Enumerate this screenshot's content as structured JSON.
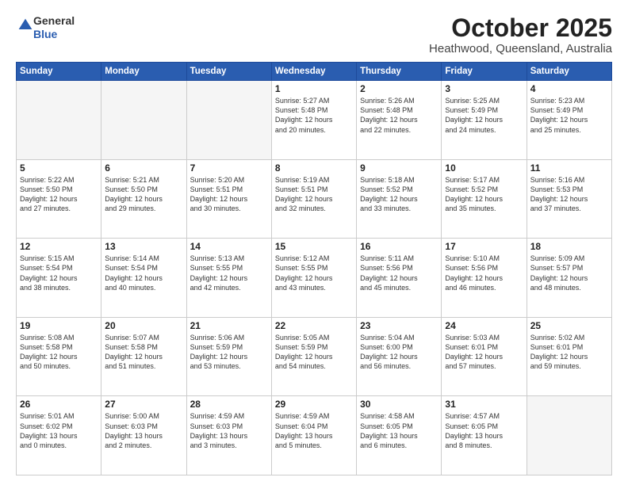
{
  "logo": {
    "general": "General",
    "blue": "Blue"
  },
  "header": {
    "month": "October 2025",
    "location": "Heathwood, Queensland, Australia"
  },
  "weekdays": [
    "Sunday",
    "Monday",
    "Tuesday",
    "Wednesday",
    "Thursday",
    "Friday",
    "Saturday"
  ],
  "weeks": [
    [
      {
        "day": "",
        "info": ""
      },
      {
        "day": "",
        "info": ""
      },
      {
        "day": "",
        "info": ""
      },
      {
        "day": "1",
        "info": "Sunrise: 5:27 AM\nSunset: 5:48 PM\nDaylight: 12 hours\nand 20 minutes."
      },
      {
        "day": "2",
        "info": "Sunrise: 5:26 AM\nSunset: 5:48 PM\nDaylight: 12 hours\nand 22 minutes."
      },
      {
        "day": "3",
        "info": "Sunrise: 5:25 AM\nSunset: 5:49 PM\nDaylight: 12 hours\nand 24 minutes."
      },
      {
        "day": "4",
        "info": "Sunrise: 5:23 AM\nSunset: 5:49 PM\nDaylight: 12 hours\nand 25 minutes."
      }
    ],
    [
      {
        "day": "5",
        "info": "Sunrise: 5:22 AM\nSunset: 5:50 PM\nDaylight: 12 hours\nand 27 minutes."
      },
      {
        "day": "6",
        "info": "Sunrise: 5:21 AM\nSunset: 5:50 PM\nDaylight: 12 hours\nand 29 minutes."
      },
      {
        "day": "7",
        "info": "Sunrise: 5:20 AM\nSunset: 5:51 PM\nDaylight: 12 hours\nand 30 minutes."
      },
      {
        "day": "8",
        "info": "Sunrise: 5:19 AM\nSunset: 5:51 PM\nDaylight: 12 hours\nand 32 minutes."
      },
      {
        "day": "9",
        "info": "Sunrise: 5:18 AM\nSunset: 5:52 PM\nDaylight: 12 hours\nand 33 minutes."
      },
      {
        "day": "10",
        "info": "Sunrise: 5:17 AM\nSunset: 5:52 PM\nDaylight: 12 hours\nand 35 minutes."
      },
      {
        "day": "11",
        "info": "Sunrise: 5:16 AM\nSunset: 5:53 PM\nDaylight: 12 hours\nand 37 minutes."
      }
    ],
    [
      {
        "day": "12",
        "info": "Sunrise: 5:15 AM\nSunset: 5:54 PM\nDaylight: 12 hours\nand 38 minutes."
      },
      {
        "day": "13",
        "info": "Sunrise: 5:14 AM\nSunset: 5:54 PM\nDaylight: 12 hours\nand 40 minutes."
      },
      {
        "day": "14",
        "info": "Sunrise: 5:13 AM\nSunset: 5:55 PM\nDaylight: 12 hours\nand 42 minutes."
      },
      {
        "day": "15",
        "info": "Sunrise: 5:12 AM\nSunset: 5:55 PM\nDaylight: 12 hours\nand 43 minutes."
      },
      {
        "day": "16",
        "info": "Sunrise: 5:11 AM\nSunset: 5:56 PM\nDaylight: 12 hours\nand 45 minutes."
      },
      {
        "day": "17",
        "info": "Sunrise: 5:10 AM\nSunset: 5:56 PM\nDaylight: 12 hours\nand 46 minutes."
      },
      {
        "day": "18",
        "info": "Sunrise: 5:09 AM\nSunset: 5:57 PM\nDaylight: 12 hours\nand 48 minutes."
      }
    ],
    [
      {
        "day": "19",
        "info": "Sunrise: 5:08 AM\nSunset: 5:58 PM\nDaylight: 12 hours\nand 50 minutes."
      },
      {
        "day": "20",
        "info": "Sunrise: 5:07 AM\nSunset: 5:58 PM\nDaylight: 12 hours\nand 51 minutes."
      },
      {
        "day": "21",
        "info": "Sunrise: 5:06 AM\nSunset: 5:59 PM\nDaylight: 12 hours\nand 53 minutes."
      },
      {
        "day": "22",
        "info": "Sunrise: 5:05 AM\nSunset: 5:59 PM\nDaylight: 12 hours\nand 54 minutes."
      },
      {
        "day": "23",
        "info": "Sunrise: 5:04 AM\nSunset: 6:00 PM\nDaylight: 12 hours\nand 56 minutes."
      },
      {
        "day": "24",
        "info": "Sunrise: 5:03 AM\nSunset: 6:01 PM\nDaylight: 12 hours\nand 57 minutes."
      },
      {
        "day": "25",
        "info": "Sunrise: 5:02 AM\nSunset: 6:01 PM\nDaylight: 12 hours\nand 59 minutes."
      }
    ],
    [
      {
        "day": "26",
        "info": "Sunrise: 5:01 AM\nSunset: 6:02 PM\nDaylight: 13 hours\nand 0 minutes."
      },
      {
        "day": "27",
        "info": "Sunrise: 5:00 AM\nSunset: 6:03 PM\nDaylight: 13 hours\nand 2 minutes."
      },
      {
        "day": "28",
        "info": "Sunrise: 4:59 AM\nSunset: 6:03 PM\nDaylight: 13 hours\nand 3 minutes."
      },
      {
        "day": "29",
        "info": "Sunrise: 4:59 AM\nSunset: 6:04 PM\nDaylight: 13 hours\nand 5 minutes."
      },
      {
        "day": "30",
        "info": "Sunrise: 4:58 AM\nSunset: 6:05 PM\nDaylight: 13 hours\nand 6 minutes."
      },
      {
        "day": "31",
        "info": "Sunrise: 4:57 AM\nSunset: 6:05 PM\nDaylight: 13 hours\nand 8 minutes."
      },
      {
        "day": "",
        "info": ""
      }
    ]
  ]
}
